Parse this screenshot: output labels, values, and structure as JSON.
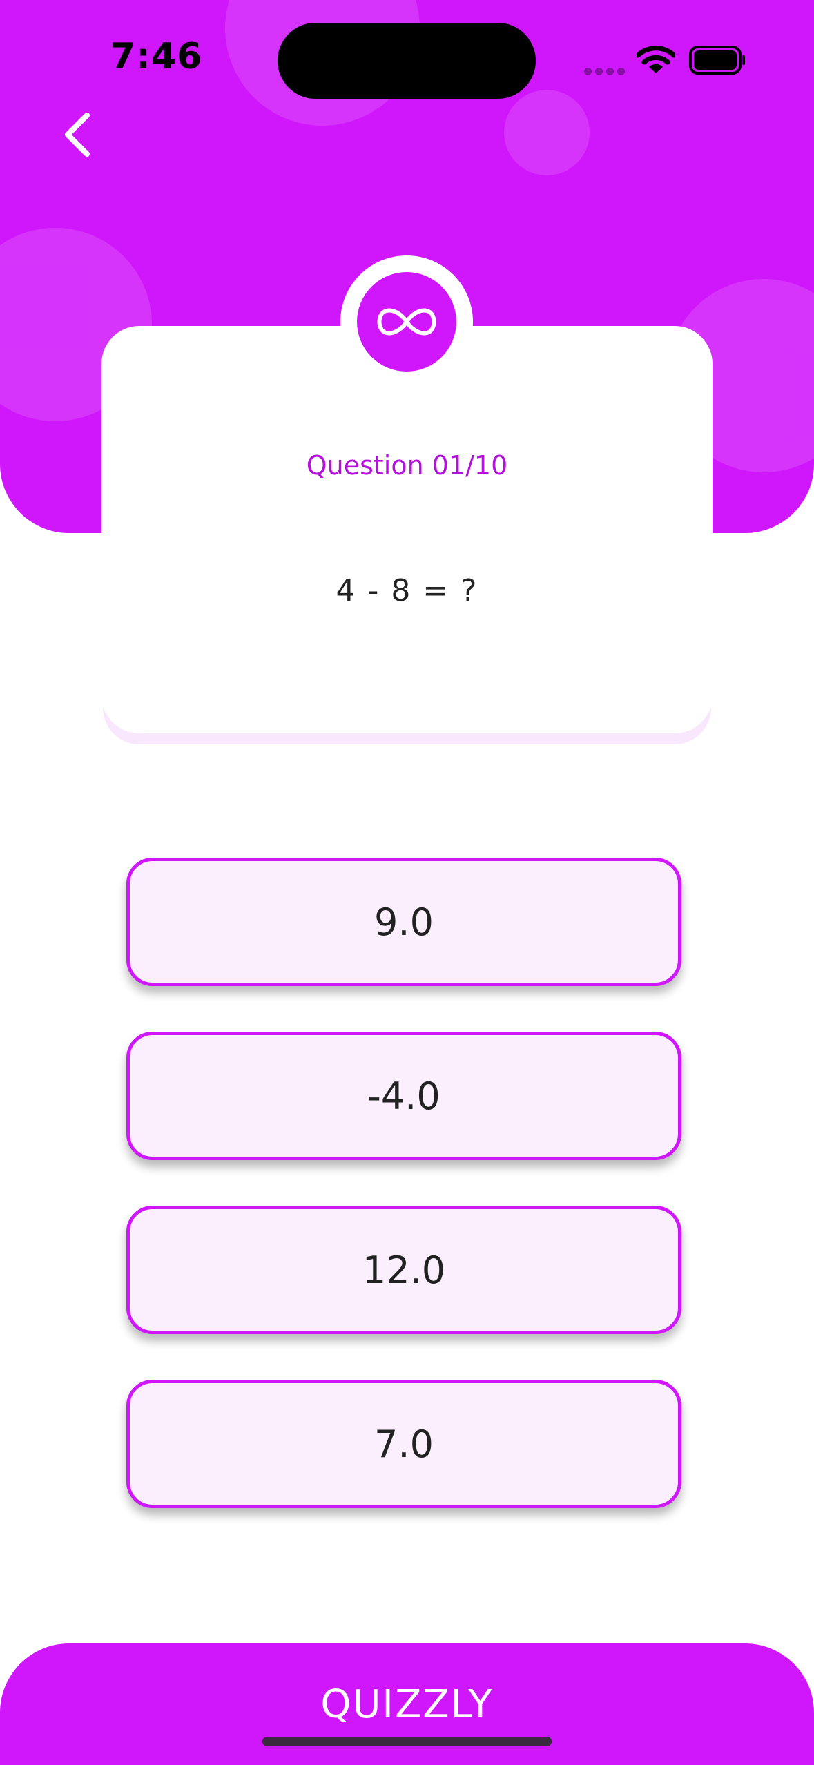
{
  "status_bar": {
    "time": "7:46"
  },
  "header": {
    "back_icon": "chevron-left-icon",
    "badge_icon": "infinity-icon",
    "badge_glyph": "∞"
  },
  "question": {
    "number_label": "Question 01/10",
    "text": "4 - 8 = ?"
  },
  "answers": [
    {
      "label": "9.0"
    },
    {
      "label": "-4.0"
    },
    {
      "label": "12.0"
    },
    {
      "label": "7.0"
    }
  ],
  "footer": {
    "title": "QUIZZLY"
  },
  "colors": {
    "accent": "#d016fb",
    "answer_bg": "#fbeefd",
    "question_label": "#b312d8"
  }
}
